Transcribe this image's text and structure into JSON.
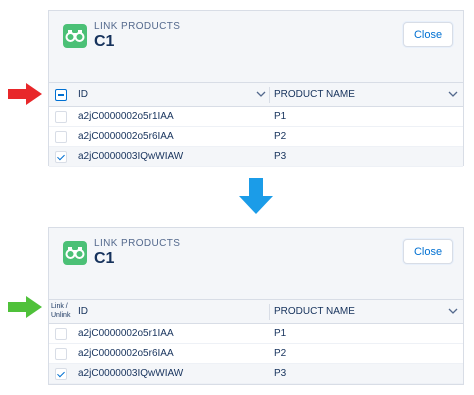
{
  "colors": {
    "accent_blue": "#0070d2",
    "icon_green": "#4bc076",
    "arrow_red": "#e8272a",
    "arrow_blue": "#1b9ce8",
    "arrow_green": "#4fc13a"
  },
  "before": {
    "header": {
      "kicker": "LINK PRODUCTS",
      "title": "C1",
      "icon": "binoculars-icon",
      "close_label": "Close"
    },
    "columns": {
      "id": "ID",
      "name": "PRODUCT NAME"
    },
    "rows": [
      {
        "id": "a2jC0000002o5r1IAA",
        "name": "P1",
        "checked": false
      },
      {
        "id": "a2jC0000002o5r6IAA",
        "name": "P2",
        "checked": false
      },
      {
        "id": "a2jC0000003IQwWIAW",
        "name": "P3",
        "checked": true
      }
    ]
  },
  "after": {
    "header": {
      "kicker": "LINK PRODUCTS",
      "title": "C1",
      "icon": "binoculars-icon",
      "close_label": "Close"
    },
    "columns": {
      "select": "Link / Unlink",
      "id": "ID",
      "name": "PRODUCT NAME"
    },
    "rows": [
      {
        "id": "a2jC0000002o5r1IAA",
        "name": "P1",
        "checked": false
      },
      {
        "id": "a2jC0000002o5r6IAA",
        "name": "P2",
        "checked": false
      },
      {
        "id": "a2jC0000003IQwWIAW",
        "name": "P3",
        "checked": true
      }
    ]
  },
  "arrows": [
    "right-arrow-icon",
    "down-arrow-icon",
    "right-arrow-icon"
  ]
}
